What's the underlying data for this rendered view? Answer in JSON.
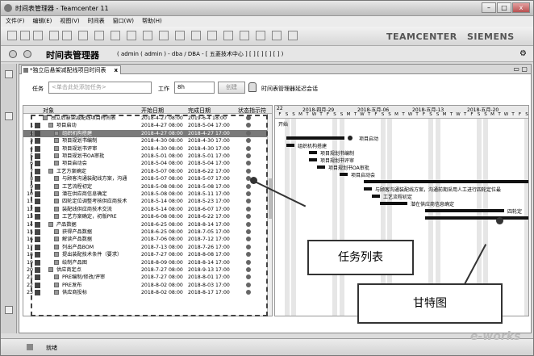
{
  "window": {
    "title": "时间表管理器 - Teamcenter 11"
  },
  "menu": [
    "文件(F)",
    "编辑(E)",
    "视图(V)",
    "时间表",
    "窗口(W)",
    "帮助(H)"
  ],
  "brand": {
    "left": "TEAMCENTER",
    "right": "SIEMENS"
  },
  "address": {
    "app_title": "时间表管理器",
    "context": "( admin ( admin ) - dba / DBA - [ 五菱技术中心 ] [ ] [ ] [ ] [ ] )"
  },
  "tab": {
    "label": "*独立后悬架减配线项目时间表",
    "close": "x"
  },
  "task_bar": {
    "task_label": "任务",
    "task_placeholder": "<单击此处添加任务>",
    "work_label": "工作",
    "work_value": "8h",
    "create_button": "创建",
    "lock_text": "时间表管理器延迟会话"
  },
  "table": {
    "headers": {
      "object": "对象",
      "start": "开始日期",
      "end": "完成日期",
      "status": "状态指示符"
    },
    "rows": [
      {
        "num": "",
        "name": "独立后悬架减配线项目时间表",
        "start": "2018-4-27 08:00",
        "end": "2019-6-4 18:00",
        "level": 0,
        "sel": false
      },
      {
        "num": "1",
        "name": "项目启动",
        "start": "2018-4-27 08:00",
        "end": "2018-5-04 17:00",
        "level": 1,
        "sel": false
      },
      {
        "num": "2",
        "name": "组织机构搭建",
        "start": "2018-4-27 08:00",
        "end": "2018-4-27 17:00",
        "level": 2,
        "sel": true
      },
      {
        "num": "3",
        "name": "项目规划书编制",
        "start": "2018-4-30 08:00",
        "end": "2018-4-30 17:00",
        "level": 2,
        "sel": false
      },
      {
        "num": "4",
        "name": "项目规划书评审",
        "start": "2018-4-30 08:00",
        "end": "2018-4-30 17:00",
        "level": 2,
        "sel": false
      },
      {
        "num": "5",
        "name": "项目规划书OA审批",
        "start": "2018-5-01 08:00",
        "end": "2018-5-01 17:00",
        "level": 2,
        "sel": false
      },
      {
        "num": "6",
        "name": "项目启动会",
        "start": "2018-5-04 08:00",
        "end": "2018-5-04 17:00",
        "level": 2,
        "sel": false
      },
      {
        "num": "7",
        "name": "工艺方案确定",
        "start": "2018-5-07 08:00",
        "end": "2018-6-22 17:00",
        "level": 1,
        "sel": false
      },
      {
        "num": "8",
        "name": "与顾客沟通装配线方案，沟通",
        "start": "2018-5-07 08:00",
        "end": "2018-5-07 17:00",
        "level": 2,
        "sel": false
      },
      {
        "num": "9",
        "name": "工艺流程初定",
        "start": "2018-5-08 08:00",
        "end": "2018-5-08 17:00",
        "level": 2,
        "sel": false
      },
      {
        "num": "10",
        "name": "潜在供应商信息确定",
        "start": "2018-5-08 08:00",
        "end": "2018-5-11 17:00",
        "level": 2,
        "sel": false
      },
      {
        "num": "11",
        "name": "四轮定位调整考核供应商技术",
        "start": "2018-5-14 08:00",
        "end": "2018-5-23 17:00",
        "level": 2,
        "sel": false
      },
      {
        "num": "12",
        "name": "装配线供应商技术交流",
        "start": "2018-5-14 08:00",
        "end": "2018-6-07 17:00",
        "level": 2,
        "sel": false
      },
      {
        "num": "13",
        "name": "工艺方案确定，初版PRE",
        "start": "2018-6-08 08:00",
        "end": "2018-6-22 17:00",
        "level": 2,
        "sel": false
      },
      {
        "num": "14",
        "name": "产品数据",
        "start": "2018-6-25 08:00",
        "end": "2018-8-14 17:00",
        "level": 1,
        "sel": false
      },
      {
        "num": "15",
        "name": "获得产品数据",
        "start": "2018-6-25 08:00",
        "end": "2018-7-05 17:00",
        "level": 2,
        "sel": false
      },
      {
        "num": "16",
        "name": "解读产品数据",
        "start": "2018-7-06 08:00",
        "end": "2018-7-12 17:00",
        "level": 2,
        "sel": false
      },
      {
        "num": "17",
        "name": "列出产品BOM",
        "start": "2018-7-13 08:00",
        "end": "2018-7-26 17:00",
        "level": 2,
        "sel": false
      },
      {
        "num": "18",
        "name": "提出装配技术条件（要求）",
        "start": "2018-7-27 08:00",
        "end": "2018-8-08 17:00",
        "level": 2,
        "sel": false
      },
      {
        "num": "19",
        "name": "绘制产品图",
        "start": "2018-8-09 08:00",
        "end": "2018-8-14 17:00",
        "level": 2,
        "sel": false
      },
      {
        "num": "20",
        "name": "供应商定点",
        "start": "2018-7-27 08:00",
        "end": "2018-9-13 17:00",
        "level": 1,
        "sel": false
      },
      {
        "num": "21",
        "name": "PRE编制/修改/评审",
        "start": "2018-7-27 08:00",
        "end": "2018-8-01 17:00",
        "level": 2,
        "sel": false
      },
      {
        "num": "22",
        "name": "PRE发布",
        "start": "2018-8-02 08:00",
        "end": "2018-8-03 17:00",
        "level": 2,
        "sel": false
      },
      {
        "num": "23",
        "name": "供应商投标",
        "start": "2018-8-02 08:00",
        "end": "2018-8-17 17:00",
        "level": 2,
        "sel": false
      }
    ]
  },
  "gantt": {
    "weeks": [
      "22",
      "2018-四月-29",
      "2018-五月-06",
      "2018-五月-13",
      "2018-五月-20"
    ],
    "days": [
      "F",
      "S",
      "S",
      "M",
      "T",
      "W",
      "T",
      "F",
      "S",
      "S",
      "M",
      "T",
      "W",
      "T",
      "F",
      "S",
      "S",
      "M",
      "T",
      "W",
      "T",
      "F",
      "S",
      "S",
      "M",
      "T",
      "W",
      "T",
      "F",
      "S",
      "S",
      "M",
      "T",
      "W",
      "T",
      "F",
      "S"
    ],
    "root_label": "开始",
    "labels": {
      "kickoff": "项目启动",
      "org": "组织机构搭建",
      "plan_edit": "项目规划书编制",
      "plan_review": "项目规划书评审",
      "plan_oa": "项目规划书OA审批",
      "kickoff_meeting": "项目启动会",
      "customer": "与顾客沟通装配线方案，沟通前期采用人工进行四轮定位最",
      "process": "工艺流程初定",
      "supplier": "潜在供应商信息确定",
      "wheel": "四轮定"
    }
  },
  "callouts": {
    "task_list": "任务列表",
    "gantt": "甘特图"
  },
  "status": {
    "text": "就绪"
  },
  "watermark": "e-works"
}
